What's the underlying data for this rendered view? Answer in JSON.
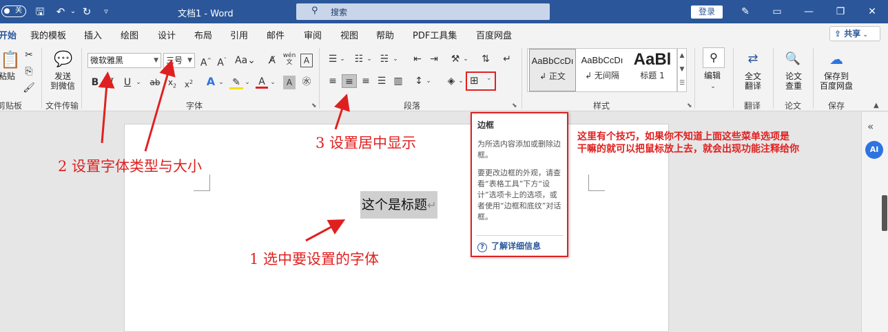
{
  "titlebar": {
    "autosave_label": "关",
    "doc_title": "文档1 - Word",
    "search_placeholder": "搜索",
    "login": "登录"
  },
  "tabs": [
    "开始",
    "我的模板",
    "插入",
    "绘图",
    "设计",
    "布局",
    "引用",
    "邮件",
    "审阅",
    "视图",
    "帮助",
    "PDF工具集",
    "百度网盘"
  ],
  "share": "共享",
  "ribbon": {
    "paste": "粘贴",
    "clipboard_group": "剪贴板",
    "send_wechat_1": "发送",
    "send_wechat_2": "到微信",
    "file_transfer_group": "文件传输",
    "font_name": "微软雅黑",
    "font_size": "三号",
    "font_group": "字体",
    "paragraph_group": "段落",
    "styles": [
      {
        "sample": "AaBbCcDı",
        "name": "↲ 正文"
      },
      {
        "sample": "AaBbCcDı",
        "name": "↲ 无间隔"
      },
      {
        "sample": "AaBl",
        "name": "标题 1"
      }
    ],
    "styles_group": "样式",
    "edit": "编辑",
    "translate_1": "全文",
    "translate_2": "翻译",
    "translate_group": "翻译",
    "paper_1": "论文",
    "paper_2": "查重",
    "paper_group": "论文",
    "save_baidu_1": "保存到",
    "save_baidu_2": "百度网盘",
    "save_group": "保存"
  },
  "document": {
    "selected_text": "这个是标题",
    "para_mark": "↵"
  },
  "tooltip": {
    "title": "边框",
    "body1": "为所选内容添加或删除边框。",
    "body2": "要更改边框的外观，请查看“表格工具”下方“设计”选项卡上的选项，或者使用“边框和底纹”对话框。",
    "link": "了解详细信息"
  },
  "sidebar": {
    "ai": "AI"
  },
  "annotations": {
    "a1": "1  选中要设置的字体",
    "a2": "2  设置字体类型与大小",
    "a3": "3  设置居中显示",
    "tip_line1": "这里有个技巧，如果你不知道上面这些菜单选项是",
    "tip_line2": "干嘛的就可以把鼠标放上去，就会出现功能注释给你"
  },
  "colors": {
    "accent": "#2b579a",
    "annotation": "#e02020"
  }
}
